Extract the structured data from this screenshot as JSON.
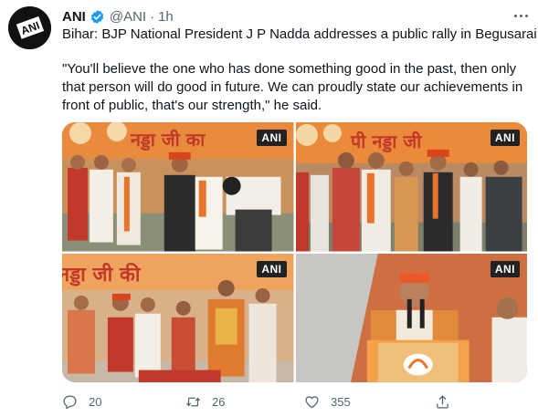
{
  "tweet": {
    "author_name": "ANI",
    "author_handle": "@ANI",
    "separator": "·",
    "time": "1h",
    "avatar_text": "ANI",
    "line1": "Bihar: BJP National President J P Nadda addresses a public rally in Begusarai",
    "line2": "\"You'll believe the one who has done something good in the past, then only that person will do good in future. We can proudly state our achievements in front of public, that's our strength,\" he said."
  },
  "media": {
    "watermark": "ANI",
    "photos": [
      {
        "name": "photo-1",
        "banner_text": "नड्डा जी का"
      },
      {
        "name": "photo-2",
        "banner_text": "पी नड्डा जी"
      },
      {
        "name": "photo-3",
        "banner_text": "नड्डा जी की"
      },
      {
        "name": "photo-4",
        "banner_text": ""
      }
    ]
  },
  "actions": {
    "replies": "20",
    "retweets": "26",
    "likes": "355"
  },
  "icons": [
    "verified-icon",
    "more-icon",
    "reply-icon",
    "retweet-icon",
    "like-icon",
    "share-icon"
  ],
  "colors": {
    "saffron": "#e8742a",
    "verified": "#1d9bf0",
    "muted": "#536471"
  }
}
